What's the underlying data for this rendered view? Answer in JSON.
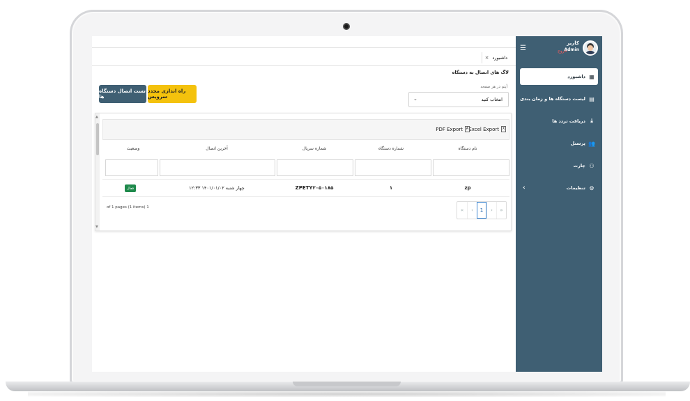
{
  "sidebar": {
    "user_name": "کاربر",
    "user_role": "Admin",
    "logout_label": "خروج",
    "items": [
      {
        "label": "داشبورد",
        "icon": "dashboard-icon"
      },
      {
        "label": "لیست دستگاه ها و زمان بندی",
        "icon": "devices-icon"
      },
      {
        "label": "دریافت تردد ها",
        "icon": "download-icon"
      },
      {
        "label": "پرسنل",
        "icon": "people-icon"
      },
      {
        "label": "چارت",
        "icon": "chart-icon"
      },
      {
        "label": "تنظیمات",
        "icon": "settings-icon"
      }
    ]
  },
  "tab": {
    "label": "داشبورد",
    "close": "×"
  },
  "page": {
    "title": "لاگ های اتصال به دستگاه"
  },
  "filters": {
    "items_per_page_label": "آیتم در هر صفحه",
    "select_value": "انتخاب کنید",
    "select_arrow": "⌄",
    "restart_label": "راه اندازی مجدد سرویس",
    "test_label": "تست اتصال دستگاه ها"
  },
  "grid": {
    "excel_label": "Excel Export",
    "pdf_label": "PDF Export",
    "columns": [
      "نام دستگاه",
      "شماره دستگاه",
      "شماره سریال",
      "آخرین اتصال",
      "وضعیت"
    ],
    "rows": [
      {
        "name": "zp",
        "number": "۱",
        "serial": "ZPETY۲۰۵۰۱۸۵",
        "last_connection": "چهار شنبه ۱۴۰۱/۰۱/۰۲ ۱۲:۳۳",
        "status": "فعال"
      }
    ],
    "pager_info": "of 1 pages (1 items) 1",
    "pager": {
      "first": "«",
      "prev": "‹",
      "current": "1",
      "next": "›",
      "last": "»"
    }
  },
  "colors": {
    "sidebar": "#3f5f73",
    "restart": "#f4c20d",
    "test": "#3f5f73",
    "status": "#1f8a4c"
  }
}
